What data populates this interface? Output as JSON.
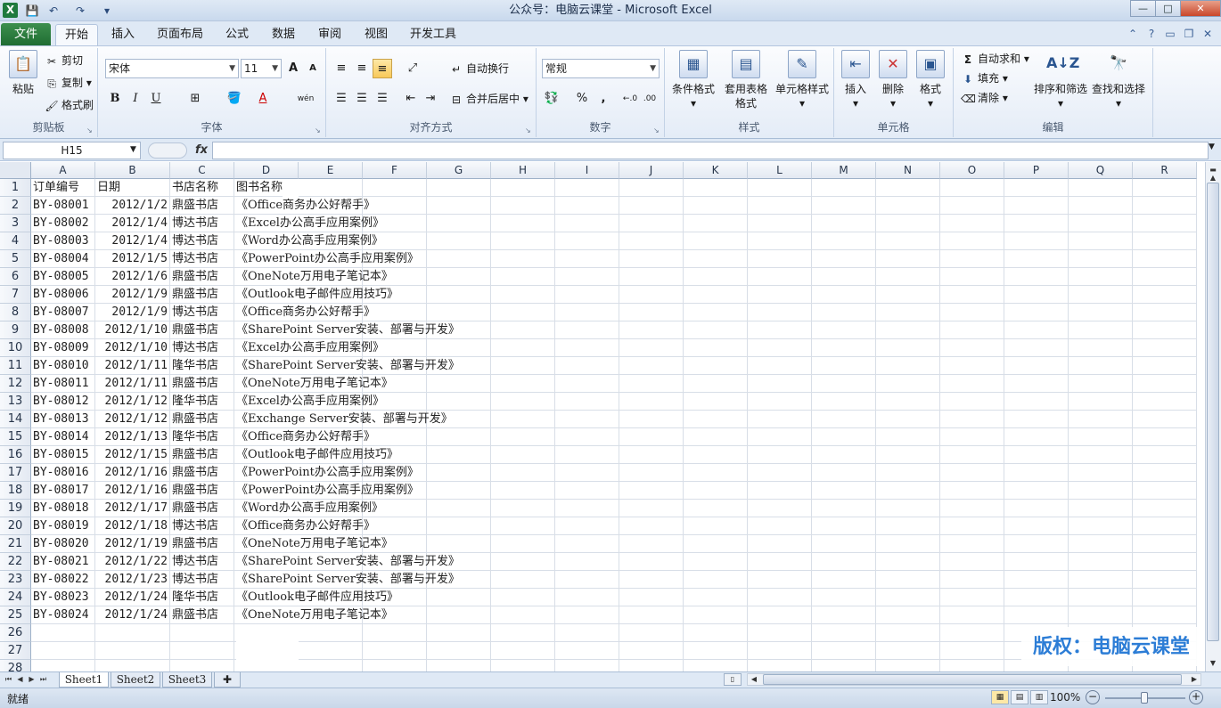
{
  "window": {
    "title": "公众号：电脑云课堂 - Microsoft Excel",
    "app_icon": "X",
    "controls": {
      "minimize": "—",
      "maximize": "□",
      "close": "✕"
    }
  },
  "qat": {
    "save": "💾",
    "undo": "↶",
    "redo": "↷",
    "more": "▾"
  },
  "tabs": {
    "file": "文件",
    "items": [
      "开始",
      "插入",
      "页面布局",
      "公式",
      "数据",
      "审阅",
      "视图",
      "开发工具"
    ],
    "active": "开始"
  },
  "ribbon": {
    "clipboard": {
      "label": "剪贴板",
      "paste": "粘贴",
      "cut": "剪切",
      "copy": "复制",
      "format_painter": "格式刷"
    },
    "font": {
      "label": "字体",
      "font_name": "宋体",
      "font_size": "11",
      "bold": "B",
      "italic": "I",
      "underline": "U",
      "grow": "A",
      "shrink": "A",
      "wen": "wén"
    },
    "alignment": {
      "label": "对齐方式",
      "wrap": "自动换行",
      "merge": "合并后居中"
    },
    "number": {
      "label": "数字",
      "format": "常规",
      "percent": "%",
      "comma": ","
    },
    "styles": {
      "label": "样式",
      "conditional": "条件格式",
      "table": "套用表格格式",
      "cell_styles": "单元格样式"
    },
    "cells": {
      "label": "单元格",
      "insert": "插入",
      "delete": "删除",
      "format": "格式"
    },
    "editing": {
      "label": "编辑",
      "autosum": "自动求和",
      "fill": "填充",
      "clear": "清除",
      "sort_filter": "排序和筛选",
      "find_select": "查找和选择"
    }
  },
  "formula_bar": {
    "name_box": "H15",
    "fx": "fx",
    "value": ""
  },
  "columns": [
    "A",
    "B",
    "C",
    "D",
    "E",
    "F",
    "G",
    "H",
    "I",
    "J",
    "K",
    "L",
    "M",
    "N",
    "O",
    "P",
    "Q",
    "R"
  ],
  "rows": [
    [
      "订单编号",
      "日期",
      "书店名称",
      "图书名称"
    ],
    [
      "BY-08001",
      "2012/1/2",
      "鼎盛书店",
      "《Office商务办公好帮手》"
    ],
    [
      "BY-08002",
      "2012/1/4",
      "博达书店",
      "《Excel办公高手应用案例》"
    ],
    [
      "BY-08003",
      "2012/1/4",
      "博达书店",
      "《Word办公高手应用案例》"
    ],
    [
      "BY-08004",
      "2012/1/5",
      "博达书店",
      "《PowerPoint办公高手应用案例》"
    ],
    [
      "BY-08005",
      "2012/1/6",
      "鼎盛书店",
      "《OneNote万用电子笔记本》"
    ],
    [
      "BY-08006",
      "2012/1/9",
      "鼎盛书店",
      "《Outlook电子邮件应用技巧》"
    ],
    [
      "BY-08007",
      "2012/1/9",
      "博达书店",
      "《Office商务办公好帮手》"
    ],
    [
      "BY-08008",
      "2012/1/10",
      "鼎盛书店",
      "《SharePoint Server安装、部署与开发》"
    ],
    [
      "BY-08009",
      "2012/1/10",
      "博达书店",
      "《Excel办公高手应用案例》"
    ],
    [
      "BY-08010",
      "2012/1/11",
      "隆华书店",
      "《SharePoint Server安装、部署与开发》"
    ],
    [
      "BY-08011",
      "2012/1/11",
      "鼎盛书店",
      "《OneNote万用电子笔记本》"
    ],
    [
      "BY-08012",
      "2012/1/12",
      "隆华书店",
      "《Excel办公高手应用案例》"
    ],
    [
      "BY-08013",
      "2012/1/12",
      "鼎盛书店",
      "《Exchange Server安装、部署与开发》"
    ],
    [
      "BY-08014",
      "2012/1/13",
      "隆华书店",
      "《Office商务办公好帮手》"
    ],
    [
      "BY-08015",
      "2012/1/15",
      "鼎盛书店",
      "《Outlook电子邮件应用技巧》"
    ],
    [
      "BY-08016",
      "2012/1/16",
      "鼎盛书店",
      "《PowerPoint办公高手应用案例》"
    ],
    [
      "BY-08017",
      "2012/1/16",
      "鼎盛书店",
      "《PowerPoint办公高手应用案例》"
    ],
    [
      "BY-08018",
      "2012/1/17",
      "鼎盛书店",
      "《Word办公高手应用案例》"
    ],
    [
      "BY-08019",
      "2012/1/18",
      "博达书店",
      "《Office商务办公好帮手》"
    ],
    [
      "BY-08020",
      "2012/1/19",
      "鼎盛书店",
      "《OneNote万用电子笔记本》"
    ],
    [
      "BY-08021",
      "2012/1/22",
      "博达书店",
      "《SharePoint Server安装、部署与开发》"
    ],
    [
      "BY-08022",
      "2012/1/23",
      "博达书店",
      "《SharePoint Server安装、部署与开发》"
    ],
    [
      "BY-08023",
      "2012/1/24",
      "隆华书店",
      "《Outlook电子邮件应用技巧》"
    ],
    [
      "BY-08024",
      "2012/1/24",
      "鼎盛书店",
      "《OneNote万用电子笔记本》"
    ],
    [],
    [],
    []
  ],
  "sheets": [
    "Sheet1",
    "Sheet2",
    "Sheet3"
  ],
  "active_sheet": "Sheet1",
  "status": {
    "ready": "就绪",
    "zoom": "100%",
    "zoom_level_percent": 100
  },
  "watermark": "版权：电脑云课堂"
}
